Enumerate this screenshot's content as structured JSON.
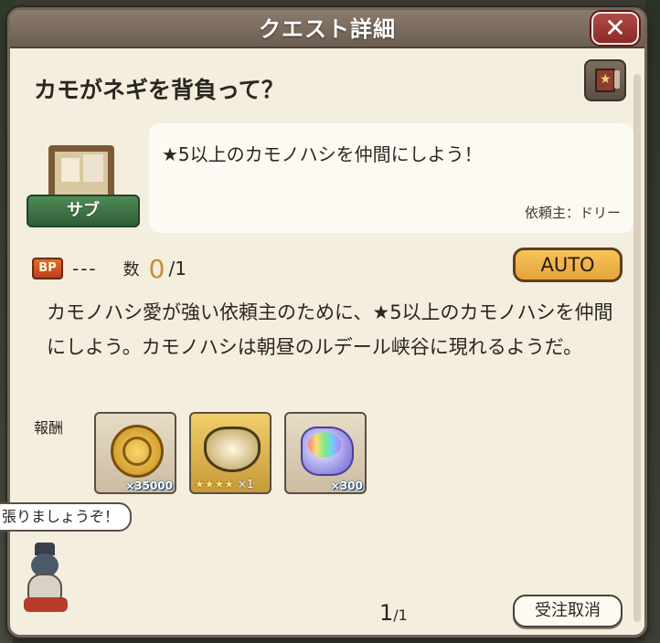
{
  "dialog": {
    "title": "クエスト詳細",
    "close_label": "✕"
  },
  "quest": {
    "name": "カモがネギを背負って？",
    "badge_label": "サブ",
    "summary": "★5以上のカモノハシを仲間にしよう！",
    "client": "依頼主：ドリー",
    "bp_icon_label": "BP",
    "bp_value": "---",
    "count_label": "数",
    "count_current": "0",
    "count_total": "/1",
    "auto_label": "AUTO",
    "description": "カモノハシ愛が強い依頼主のために、★5以上のカモノハシを仲間にしよう。カモノハシは朝昼のルデール峡谷に現れるようだ。"
  },
  "rewards": {
    "label": "報酬",
    "items": [
      {
        "name": "coin",
        "qty": "×35000"
      },
      {
        "name": "gold-ring",
        "stars": "★★★★",
        "qty": "×1"
      },
      {
        "name": "rainbow-crystal",
        "qty": "×300"
      }
    ]
  },
  "mascot": {
    "speech": "張りましょうぞ！"
  },
  "footer": {
    "page_current": "1",
    "page_total": "/1",
    "cancel_label": "受注取消"
  },
  "colors": {
    "title_bar": "#7a6b5c",
    "close_button": "#9e3a37",
    "auto_button": "#f0b54a",
    "count_accent": "#c88a37",
    "sub_ribbon": "#3f7648"
  }
}
